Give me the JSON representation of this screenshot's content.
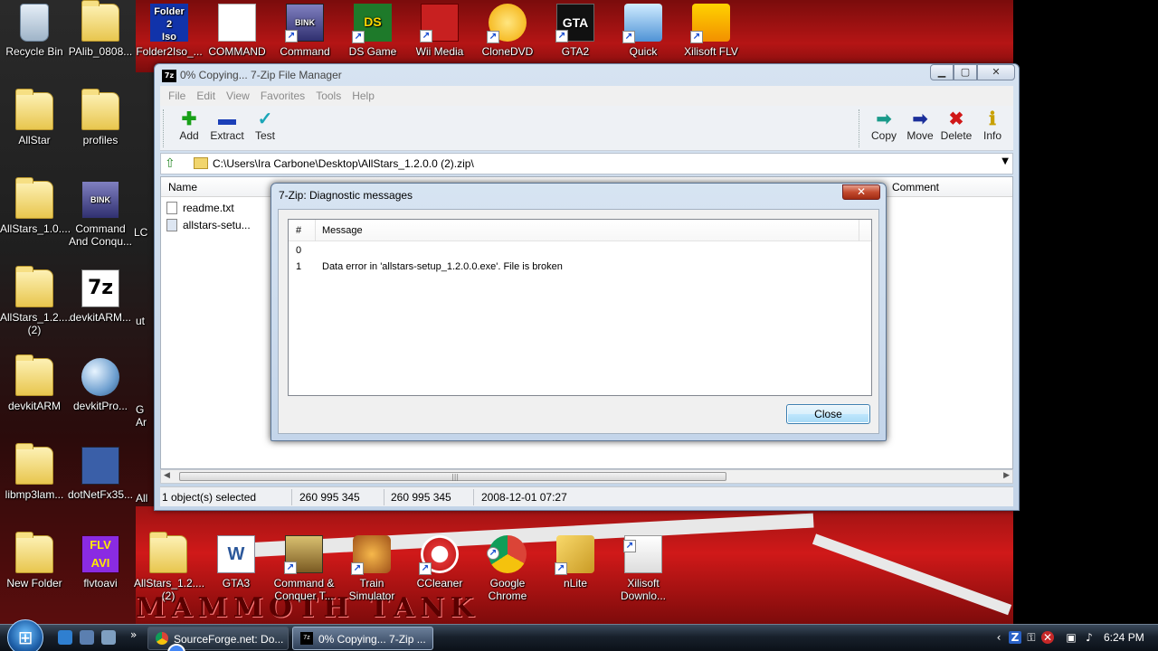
{
  "desktop": {
    "wallpaper_text": "MAMMOTH TANK",
    "icons_left": [
      {
        "label": "Recycle Bin",
        "icon": "recycle-bin-icon"
      },
      {
        "label": "PAlib_0808...",
        "icon": "folder-icon"
      },
      {
        "label": "AllStar",
        "icon": "folder-icon"
      },
      {
        "label": "profiles",
        "icon": "folder-icon"
      },
      {
        "label": "AllStars_1.0....",
        "icon": "folder-icon"
      },
      {
        "label": "Command And Conqu...",
        "icon": "bink-video-icon"
      },
      {
        "label": "AllStars_1.2.... (2)",
        "icon": "folder-icon"
      },
      {
        "label": "devkitARM...",
        "icon": "7zip-icon"
      },
      {
        "label": "devkitARM",
        "icon": "folder-icon"
      },
      {
        "label": "devkitPro...",
        "icon": "installer-globe-icon"
      },
      {
        "label": "libmp3lam...",
        "icon": "folder-icon"
      },
      {
        "label": "dotNetFx35...",
        "icon": "dotnet-installer-icon"
      },
      {
        "label": "New Folder",
        "icon": "folder-icon"
      },
      {
        "label": "flvtoavi",
        "icon": "flv-avi-icon"
      }
    ],
    "icons_top": [
      {
        "label": "Folder2Iso_...",
        "icon": "folder2iso-icon"
      },
      {
        "label": "COMMAND",
        "icon": "blank-file-icon"
      },
      {
        "label": "Command",
        "icon": "bink-video-icon"
      },
      {
        "label": "DS Game",
        "icon": "ds-game-icon"
      },
      {
        "label": "Wii Media",
        "icon": "wii-media-icon"
      },
      {
        "label": "CloneDVD",
        "icon": "clonedvd-icon"
      },
      {
        "label": "GTA2",
        "icon": "gta2-icon"
      },
      {
        "label": "Quick",
        "icon": "quick-icon"
      },
      {
        "label": "Xilisoft FLV",
        "icon": "xilisoft-flv-icon"
      }
    ],
    "icons_bottom": [
      {
        "label": "AllStars_1.2.... (2)",
        "icon": "zip-folder-icon"
      },
      {
        "label": "GTA3",
        "icon": "word-document-icon"
      },
      {
        "label": "Command & Conquer T...",
        "icon": "command-conquer-icon"
      },
      {
        "label": "Train Simulator",
        "icon": "train-simulator-icon"
      },
      {
        "label": "CCleaner",
        "icon": "ccleaner-icon"
      },
      {
        "label": "Google Chrome",
        "icon": "chrome-icon"
      },
      {
        "label": "nLite",
        "icon": "nlite-icon"
      },
      {
        "label": "Xilisoft Downlo...",
        "icon": "xilisoft-download-icon"
      }
    ],
    "partial_labels": [
      "LC",
      "ut",
      "G Ar",
      "All"
    ]
  },
  "main_window": {
    "title": "0% Copying... 7-Zip File Manager",
    "menu": [
      "File",
      "Edit",
      "View",
      "Favorites",
      "Tools",
      "Help"
    ],
    "toolbar_left": [
      {
        "label": "Add",
        "icon": "add-plus-icon",
        "glyph": "✚",
        "color": "#18a018"
      },
      {
        "label": "Extract",
        "icon": "extract-minus-icon",
        "glyph": "▬",
        "color": "#1b3fb8"
      },
      {
        "label": "Test",
        "icon": "test-check-icon",
        "glyph": "✓",
        "color": "#1aa6b8"
      }
    ],
    "toolbar_right": [
      {
        "label": "Copy",
        "icon": "copy-arrow-icon",
        "glyph": "➡",
        "color": "#1a9a8a"
      },
      {
        "label": "Move",
        "icon": "move-arrow-icon",
        "glyph": "➡",
        "color": "#1b2f9a"
      },
      {
        "label": "Delete",
        "icon": "delete-x-icon",
        "glyph": "✖",
        "color": "#d01818"
      },
      {
        "label": "Info",
        "icon": "info-icon",
        "glyph": "ℹ",
        "color": "#c8a000"
      }
    ],
    "address": "C:\\Users\\Ira Carbone\\Desktop\\AllStars_1.2.0.0 (2).zip\\",
    "columns": {
      "name": "Name",
      "comment": "Comment"
    },
    "files": [
      {
        "name": "readme.txt"
      },
      {
        "name": "allstars-setu..."
      }
    ],
    "status": {
      "selected": "1 object(s) selected",
      "size": "260 995 345",
      "packed": "260 995 345",
      "modified": "2008-12-01 07:27"
    }
  },
  "dialog": {
    "title": "7-Zip: Diagnostic messages",
    "columns": {
      "num": "#",
      "message": "Message"
    },
    "rows": [
      {
        "num": "0",
        "message": ""
      },
      {
        "num": "1",
        "message": "Data error in 'allstars-setup_1.2.0.0.exe'. File is broken"
      }
    ],
    "close_label": "Close",
    "close_x": "✕"
  },
  "taskbar": {
    "tasks": [
      {
        "label": "SourceForge.net: Do...",
        "icon": "chrome-icon",
        "active": false
      },
      {
        "label": "0% Copying... 7-Zip ...",
        "icon": "7zip-icon",
        "active": true
      }
    ],
    "clock": "6:24 PM"
  }
}
